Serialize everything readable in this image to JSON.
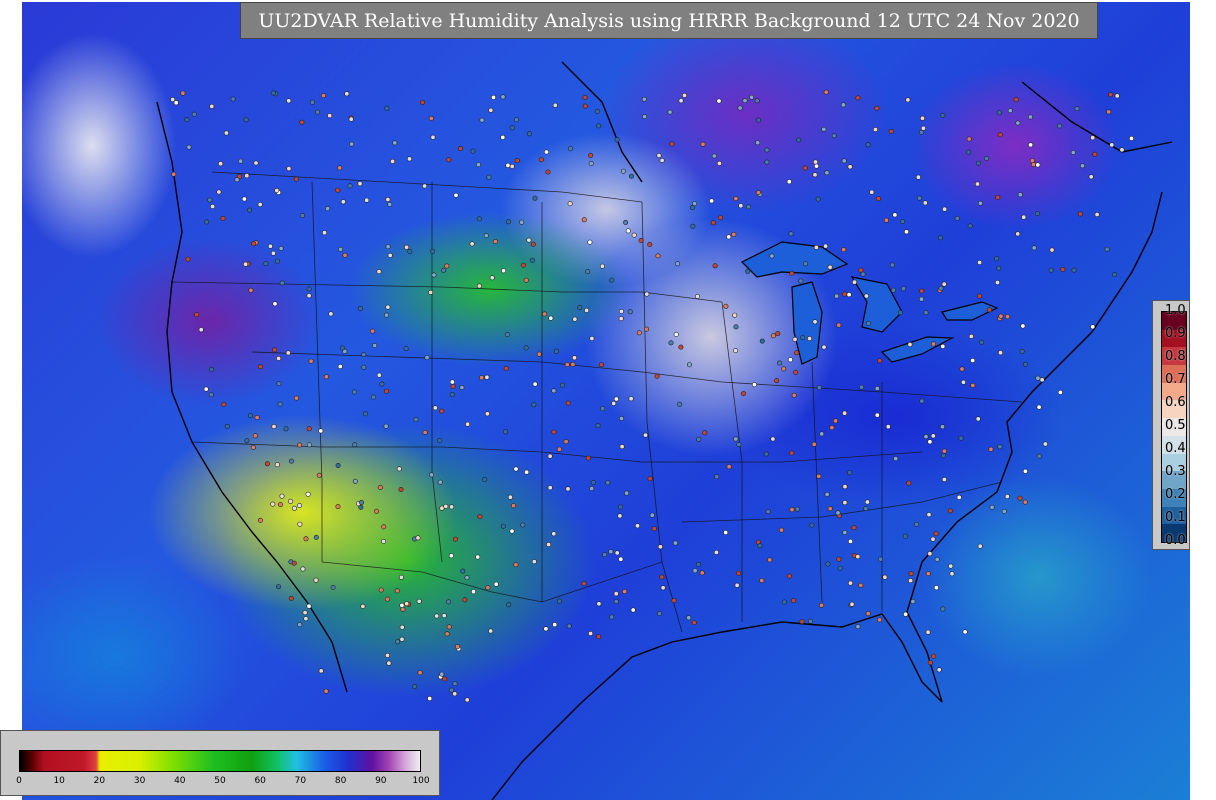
{
  "title": "UU2DVAR Relative Humidity Analysis using HRRR Background 12 UTC 24 Nov 2020",
  "obs_legend": {
    "ticks": [
      "1.0",
      "0.9",
      "0.8",
      "0.7",
      "0.6",
      "0.5",
      "0.4",
      "0.3",
      "0.2",
      "0.1",
      "0.0"
    ],
    "colors": [
      "#67001f",
      "#a50f22",
      "#c6373f",
      "#de6e56",
      "#f2a98a",
      "#f7d4c0",
      "#ece8e8",
      "#d3e2ea",
      "#a9cfe0",
      "#6fa5c9",
      "#3d82b8",
      "#1d5f9f",
      "#0a3972"
    ]
  },
  "rh_legend": {
    "ticks": [
      "0",
      "10",
      "20",
      "30",
      "40",
      "50",
      "60",
      "70",
      "80",
      "90",
      "100"
    ],
    "range": [
      0,
      100
    ]
  },
  "stations": {
    "count": 700,
    "colors": [
      "#e0e0e0",
      "#ffffff",
      "#c8452d",
      "#e07a5f",
      "#7fa8c9",
      "#4a7fb0",
      "#f3d7c6",
      "#2f6da3"
    ]
  }
}
